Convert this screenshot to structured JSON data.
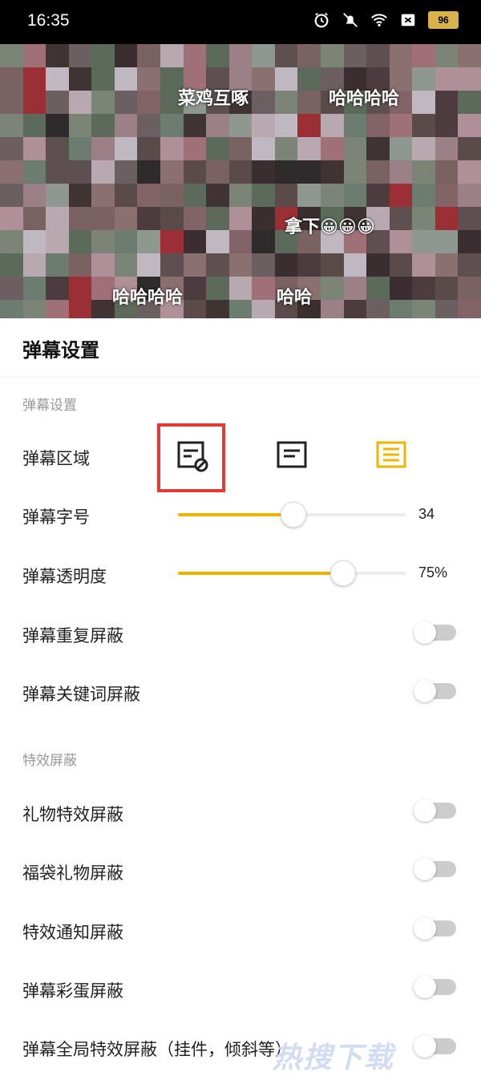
{
  "status_bar": {
    "time": "16:35",
    "battery": "96",
    "icons": [
      "alarm-icon",
      "mute-icon",
      "wifi-icon",
      "close-box-icon",
      "battery-icon"
    ]
  },
  "video": {
    "danmaku": [
      "菜鸡互啄",
      "哈哈哈哈",
      "拿下😀😀😀",
      "哈哈哈哈",
      "哈哈"
    ]
  },
  "sheet": {
    "title": "弹幕设置",
    "section1": "弹幕设置",
    "area_label": "弹幕区域",
    "area_options": [
      "area-block-icon",
      "area-half-icon",
      "area-full-icon"
    ],
    "font_size_label": "弹幕字号",
    "font_size_value": "34",
    "font_size_fraction": 0.5,
    "opacity_label": "弹幕透明度",
    "opacity_value": "75%",
    "opacity_fraction": 0.72,
    "repeat_block_label": "弹幕重复屏蔽",
    "keyword_block_label": "弹幕关键词屏蔽",
    "section2": "特效屏蔽",
    "gift_effect_label": "礼物特效屏蔽",
    "lucky_bag_label": "福袋礼物屏蔽",
    "effect_notice_label": "特效通知屏蔽",
    "easter_egg_label": "弹幕彩蛋屏蔽",
    "global_effect_label": "弹幕全局特效屏蔽（挂件，倾斜等）"
  },
  "watermark": "热搜下载",
  "colors": {
    "accent": "#f0b400",
    "highlight": "#e53935",
    "toggle_off": "#cccccc"
  }
}
